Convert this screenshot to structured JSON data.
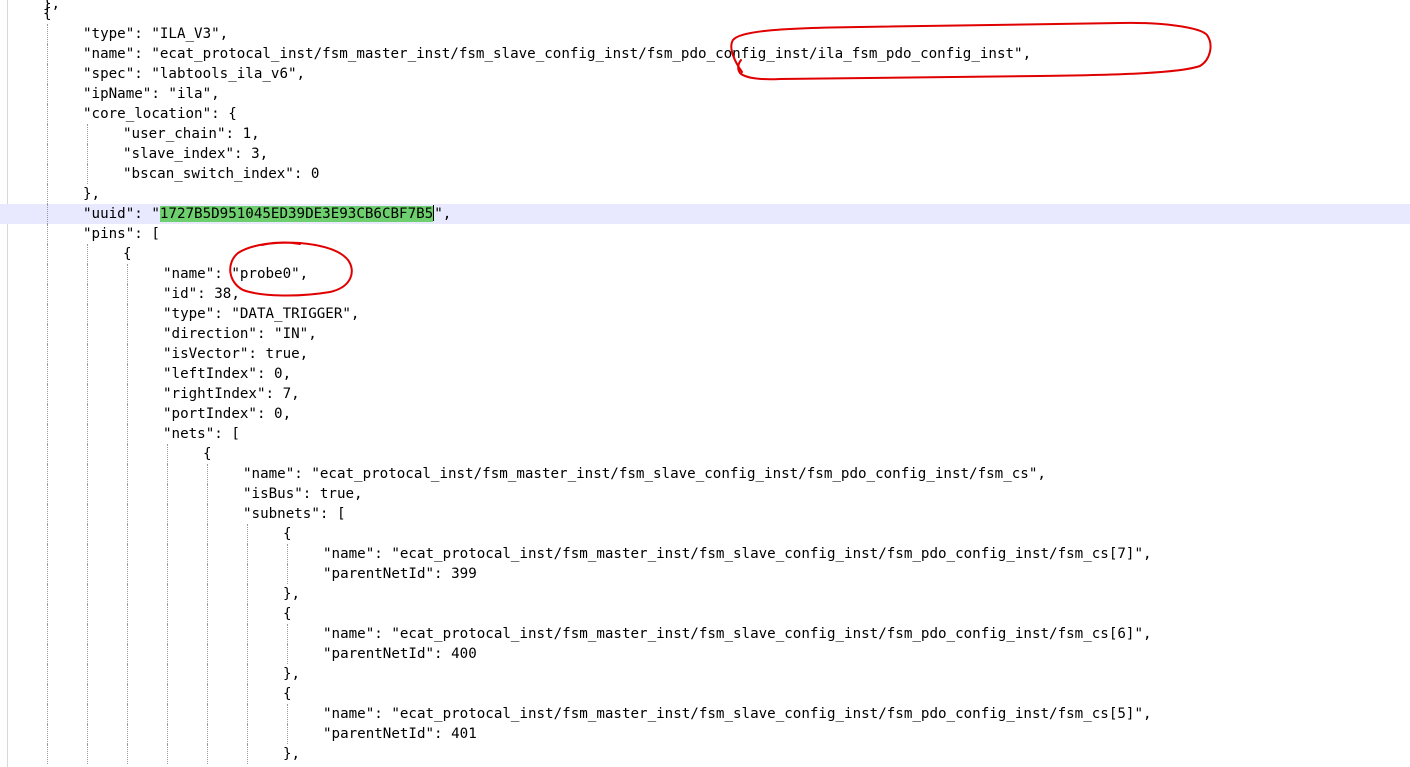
{
  "editor": {
    "selection_color": "#6dcf6d",
    "current_line_color": "#e8e8ff",
    "annotation_color": "#e00000",
    "lines": [
      "},",
      "{",
      "\"type\": \"ILA_V3\",",
      "\"name\": \"ecat_protocal_inst/fsm_master_inst/fsm_slave_config_inst/fsm_pdo_config_inst/ila_fsm_pdo_config_inst\",",
      "\"spec\": \"labtools_ila_v6\",",
      "\"ipName\": \"ila\",",
      "\"core_location\": {",
      "\"user_chain\": 1,",
      "\"slave_index\": 3,",
      "\"bscan_switch_index\": 0",
      "},",
      "\"uuid\": \"",
      "\"pins\": [",
      "{",
      "\"name\": \"probe0\",",
      "\"id\": 38,",
      "\"type\": \"DATA_TRIGGER\",",
      "\"direction\": \"IN\",",
      "\"isVector\": true,",
      "\"leftIndex\": 0,",
      "\"rightIndex\": 7,",
      "\"portIndex\": 0,",
      "\"nets\": [",
      "{",
      "\"name\": \"ecat_protocal_inst/fsm_master_inst/fsm_slave_config_inst/fsm_pdo_config_inst/fsm_cs\",",
      "\"isBus\": true,",
      "\"subnets\": [",
      "{",
      "\"name\": \"ecat_protocal_inst/fsm_master_inst/fsm_slave_config_inst/fsm_pdo_config_inst/fsm_cs[7]\",",
      "\"parentNetId\": 399",
      "},",
      "{",
      "\"name\": \"ecat_protocal_inst/fsm_master_inst/fsm_slave_config_inst/fsm_pdo_config_inst/fsm_cs[6]\",",
      "\"parentNetId\": 400",
      "},",
      "{",
      "\"name\": \"ecat_protocal_inst/fsm_master_inst/fsm_slave_config_inst/fsm_pdo_config_inst/fsm_cs[5]\",",
      "\"parentNetId\": 401",
      "},"
    ],
    "uuid_selected": "1727B5D951045ED39DE3E93CB6CBF7B5",
    "uuid_tail": "\","
  }
}
